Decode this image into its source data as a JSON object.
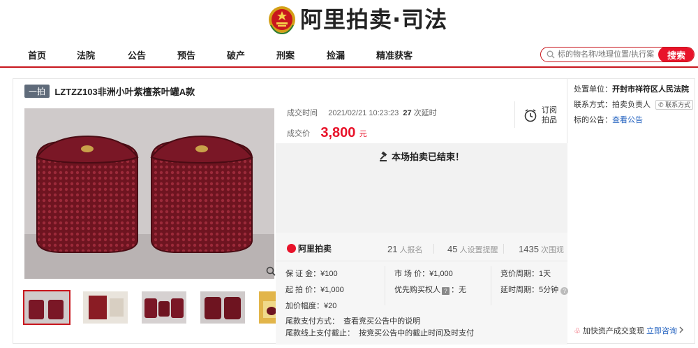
{
  "header": {
    "brand_main": "阿里拍卖",
    "brand_dot": "·",
    "brand_sub": "司法"
  },
  "nav": {
    "items": [
      "首页",
      "法院",
      "公告",
      "预告",
      "破产",
      "刑案",
      "捡漏",
      "精准获客"
    ]
  },
  "search": {
    "placeholder": "标的物名称/地理位置/执行案",
    "button_label": "搜索"
  },
  "item": {
    "tag": "一拍",
    "title": "LZTZZ103非洲小叶紫檀茶叶罐A款"
  },
  "deal": {
    "time_label": "成交时间",
    "time_value": "2021/02/21 10:23:23",
    "delay_count": "27",
    "delay_label": "次延时",
    "price_label": "成交价",
    "price_value": "3,800",
    "price_unit": "元"
  },
  "subscribe": {
    "line1": "订阅",
    "line2": "拍品"
  },
  "ended": {
    "text": "本场拍卖已结束！"
  },
  "stats": {
    "logo_text": "阿里拍卖",
    "signups": "21",
    "signups_label": "人报名",
    "reminders": "45",
    "reminders_label": "人设置提醒",
    "views": "1435",
    "views_label": "次围观"
  },
  "details": {
    "deposit_label": "保 证 金：",
    "deposit_value": "¥100",
    "market_label": "市 场 价：",
    "market_value": "¥1,000",
    "cycle_label": "竞价周期：",
    "cycle_value": "1天",
    "start_label": "起 拍 价：",
    "start_value": "¥1,000",
    "priority_label": "优先购买权人",
    "priority_value": "：无",
    "delay_label": "延时周期：",
    "delay_value": "5分钟",
    "increment_label": "加价幅度：",
    "increment_value": "¥20",
    "pay_method_label": "尾款支付方式：",
    "pay_method_value": "查看竞买公告中的说明",
    "pay_deadline_label": "尾款线上支付截止：",
    "pay_deadline_value": "按竞买公告中的截止时间及时支付"
  },
  "sidebar": {
    "unit_label": "处置单位：",
    "unit_value": "开封市祥符区人民法院",
    "contact_label": "联系方式：",
    "contact_value": "拍卖负责人",
    "contact_btn": "联系方式",
    "notice_label": "标的公告：",
    "notice_link": "查看公告",
    "footer_text": "加快资产成交变现",
    "footer_link": "立即咨询"
  },
  "colors": {
    "accent": "#e8132a",
    "brand_red": "#c8161d",
    "link": "#1f5fbf"
  }
}
